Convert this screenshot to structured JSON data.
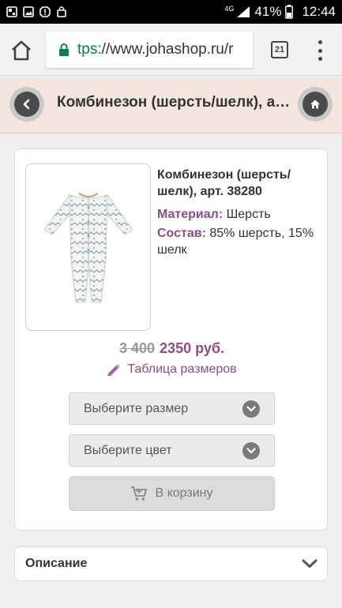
{
  "status_bar": {
    "network_type": "4G",
    "battery_percent": "41%",
    "time": "12:44"
  },
  "browser": {
    "url_scheme": "tps:",
    "url_rest": "//www.johashop.ru/r",
    "tab_count": "21"
  },
  "header": {
    "title": "Комбинезон (шерсть/шелк), ар..."
  },
  "product": {
    "name": "Комбинезон (шерсть/шелк), арт. 38280",
    "material_label": "Материал:",
    "material_value": " Шерсть",
    "composition_label": "Состав:",
    "composition_value": " 85% шерсть, 15% шелк",
    "old_price": "3 400",
    "new_price": "2350 руб.",
    "size_table_link": "Таблица размеров",
    "size_select_placeholder": "Выберите размер",
    "color_select_placeholder": "Выберите цвет",
    "cart_button": "В корзину"
  },
  "description": {
    "title": "Описание"
  },
  "colors": {
    "accent": "#8e4c88",
    "header_bg": "#f4e6df",
    "secure_green": "#0b8043"
  },
  "icons": {
    "status_left": [
      "gallery-icon",
      "image-icon",
      "alert-icon",
      "shopping-bag-icon"
    ],
    "back": "chevron-left-icon",
    "home": "home-icon",
    "cart": "cart-icon",
    "pencil": "pencil-icon",
    "expand": "chevron-down-icon"
  }
}
